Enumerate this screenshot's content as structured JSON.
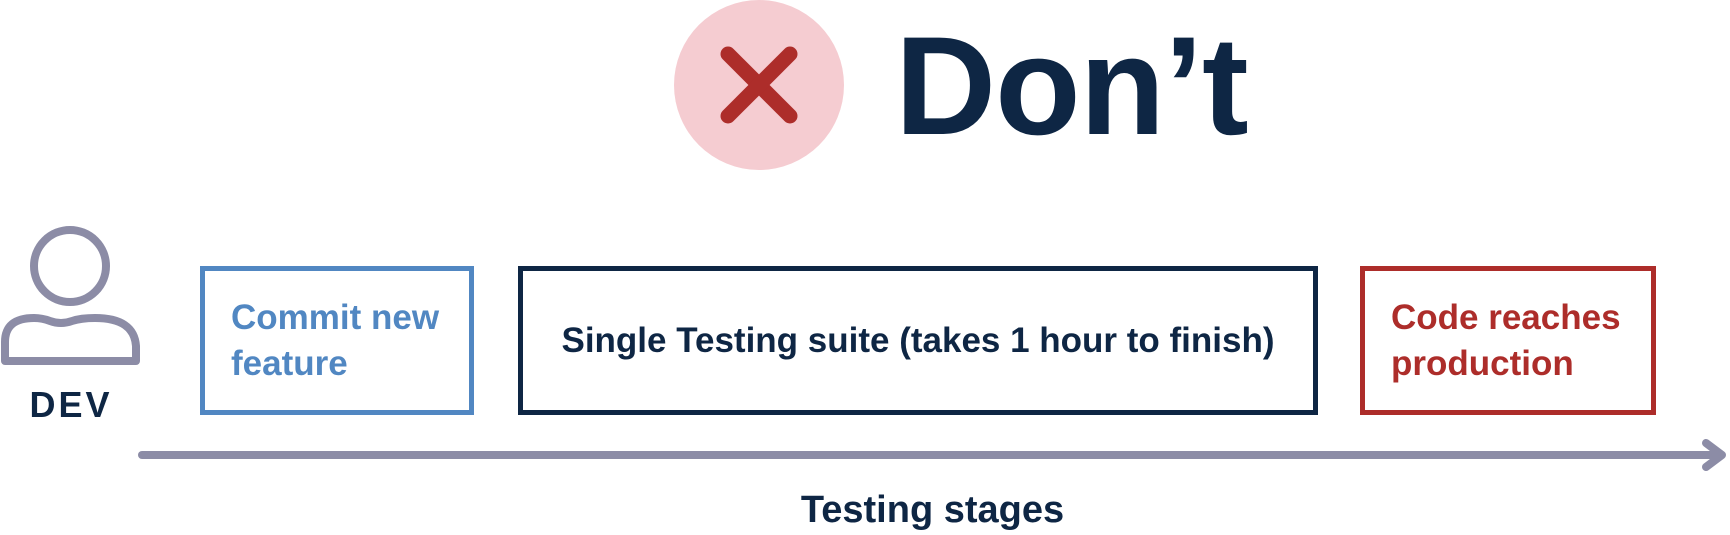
{
  "header": {
    "title": "Don’t",
    "badge_icon": "x-mark-icon",
    "badge_color": "#f5ccd1",
    "mark_color": "#ad2d2a"
  },
  "actor": {
    "icon": "person-icon",
    "label": "DEV",
    "icon_color": "#8c8ca6"
  },
  "stages": [
    {
      "label": "Commit new feature",
      "color": "#5187c2"
    },
    {
      "label": "Single Testing suite (takes 1 hour to finish)",
      "color": "#0e2644"
    },
    {
      "label": "Code reaches production",
      "color": "#ad2d2a"
    }
  ],
  "axis": {
    "label": "Testing stages",
    "color": "#8c8ca6"
  }
}
